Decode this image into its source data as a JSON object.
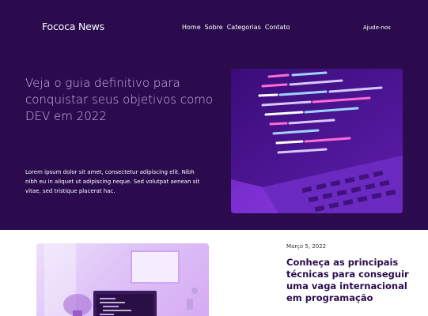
{
  "header": {
    "brand": "Fococa News",
    "nav": [
      "Home",
      "Sobre",
      "Categorias",
      "Contato"
    ],
    "help": "Ajude-nos"
  },
  "hero": {
    "title": "Veja o guia definitivo para conquistar seus objetivos como DEV em 2022",
    "description": "Lorem ipsum dolor sit amet, consectetur adipiscing elit. Nibh nibh eu in aliquet ut adipiscing neque. Sed volutpat aenean sit vitae, sed tristique placerat hac.",
    "image_icon": "code-laptop-image"
  },
  "article": {
    "date": "Março 5, 2022",
    "title": "Conheça as principais técnicas para conseguir uma vaga internacional em programação",
    "image_icon": "desk-computer-image"
  },
  "colors": {
    "hero_bg": "#2b0b4d",
    "title_lilac": "#c9b7e6",
    "accent_purple": "#7b2fd0"
  }
}
